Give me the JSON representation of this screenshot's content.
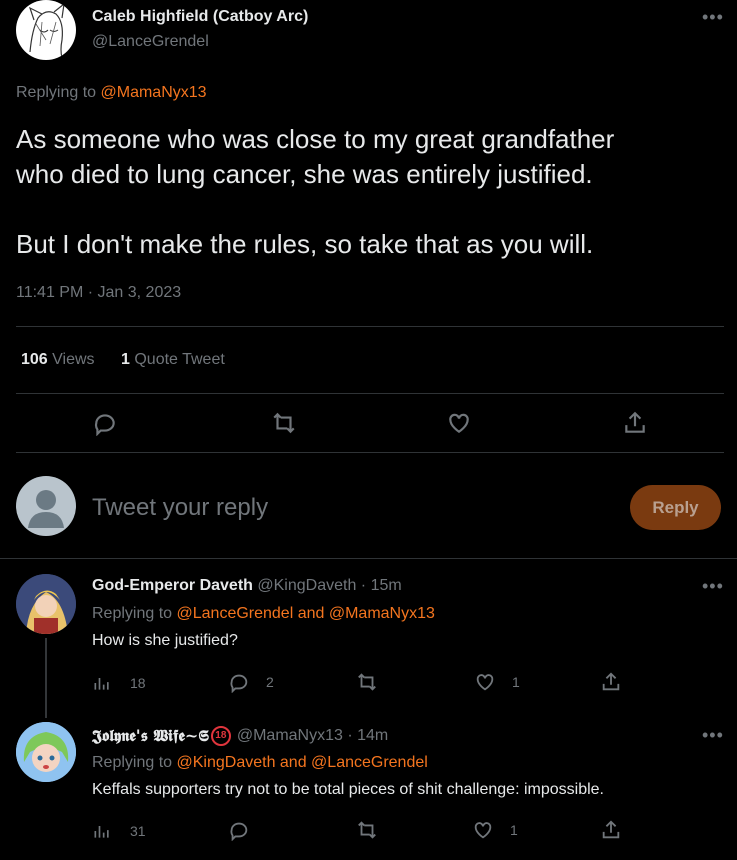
{
  "main_tweet": {
    "display_name": "Caleb Highfield (Catboy Arc)",
    "handle": "@LanceGrendel",
    "replying_prefix": "Replying to",
    "replying_to": "@MamaNyx13",
    "text_line1": "As someone who was close to my great grandfather",
    "text_line2": "who died to lung cancer, she was entirely justified.",
    "text_line3": "But I don't make the rules, so take that as you will.",
    "time": "11:41 PM",
    "date": "Jan 3, 2023",
    "views_count": "106",
    "views_label": "Views",
    "quotes_count": "1",
    "quotes_label": "Quote Tweet"
  },
  "compose": {
    "placeholder": "Tweet your reply",
    "reply_button": "Reply"
  },
  "replies": [
    {
      "display_name": "God-Emperor Daveth",
      "handle": "@KingDaveth",
      "time": "15m",
      "replying_prefix": "Replying to",
      "replying_to": "@LanceGrendel and @MamaNyx13",
      "text": "How is she justified?",
      "views": "18",
      "replies": "2",
      "retweets": "",
      "likes": "1"
    },
    {
      "display_name": "𝕵𝖔𝖑𝖞𝖓𝖊'𝖘 𝖂𝖎𝖋𝖊~𝕾",
      "age_badge": "18",
      "handle": "@MamaNyx13",
      "time": "14m",
      "replying_prefix": "Replying to",
      "replying_to": "@KingDaveth and @LanceGrendel",
      "text": "Keffals supporters try not to be total pieces of shit challenge: impossible.",
      "views": "31",
      "replies": "",
      "retweets": "",
      "likes": "1"
    }
  ],
  "colors": {
    "accent": "#f4751f",
    "reply_button_bg": "#7a3a10",
    "muted": "#71767b",
    "divider": "#2f3336"
  }
}
